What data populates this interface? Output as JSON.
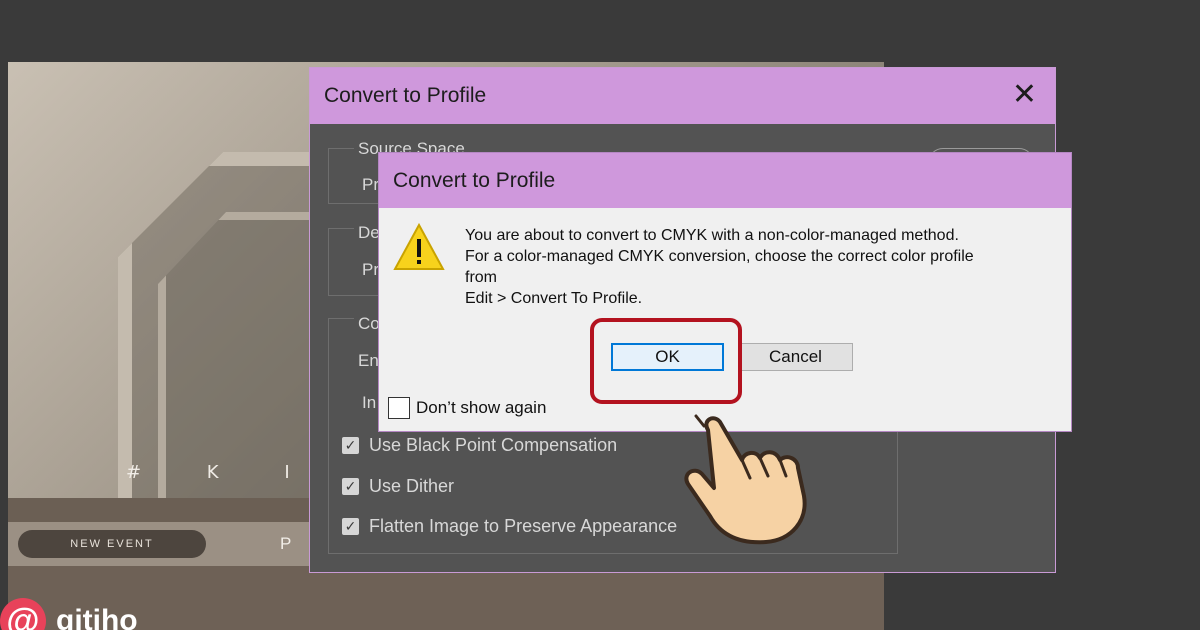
{
  "background": {
    "photo_text": "# K I M T",
    "new_event_label": "NEW EVENT",
    "bar_letter": "P",
    "logo_mark": "@",
    "logo_text": "gitiho"
  },
  "back_dialog": {
    "title": "Convert to Profile",
    "close_icon": "close-icon",
    "source_space_label": "Source Space",
    "source_profile_fragment": "Pr",
    "destination_label_fragment": "De",
    "destination_profile_fragment": "Pr",
    "conversion_label_fragment": "Co",
    "engine_fragment": "En",
    "intent_fragment": "In",
    "checkboxes": [
      {
        "label": "Use Black Point Compensation",
        "checked": true
      },
      {
        "label": "Use Dither",
        "checked": true
      },
      {
        "label": "Flatten Image to Preserve Appearance",
        "checked": true
      }
    ]
  },
  "alert": {
    "title": "Convert to Profile",
    "icon": "warning-icon",
    "message_lines": [
      "You are about to convert to CMYK with a non-color-managed method.",
      "For a color-managed CMYK conversion, choose the correct color profile",
      "from",
      "Edit > Convert To Profile."
    ],
    "ok_label": "OK",
    "cancel_label": "Cancel",
    "dont_show_label": "Don’t show again",
    "dont_show_checked": false
  },
  "colors": {
    "title_bar": "#cf98dc",
    "highlight": "#b3121f",
    "ok_focus": "#0078d7"
  }
}
